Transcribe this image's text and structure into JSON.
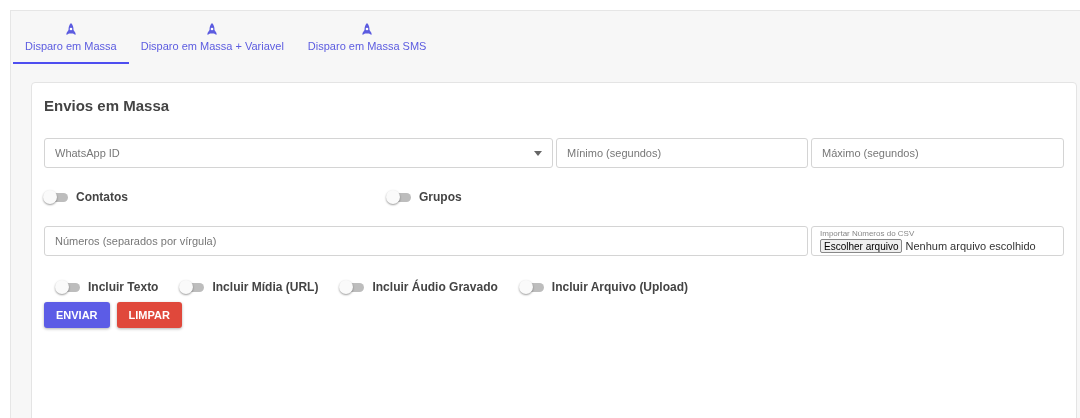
{
  "tabs": [
    {
      "label": "Disparo em Massa",
      "selected": true
    },
    {
      "label": "Disparo em Massa + Variavel",
      "selected": false
    },
    {
      "label": "Disparo em Massa SMS",
      "selected": false
    }
  ],
  "card": {
    "title": "Envios em Massa",
    "whatsapp_select": {
      "placeholder": "WhatsApp ID"
    },
    "minimum_field": {
      "placeholder": "Mínimo (segundos)"
    },
    "maximum_field": {
      "placeholder": "Máximo (segundos)"
    },
    "target_switches": [
      {
        "label": "Contatos",
        "on": false
      },
      {
        "label": "Grupos",
        "on": false
      }
    ],
    "numbers_field": {
      "placeholder": "Números (separados por vírgula)"
    },
    "csv_field": {
      "label": "Importar Números do CSV",
      "button": "Escolher arquivo",
      "status": "Nenhum arquivo escolhido"
    },
    "include_switches": [
      {
        "label": "Incluir Texto",
        "on": false
      },
      {
        "label": "Incluir Mídia (URL)",
        "on": false
      },
      {
        "label": "Incluir Áudio Gravado",
        "on": false
      },
      {
        "label": "Incluir Arquivo (Upload)",
        "on": false
      }
    ],
    "buttons": [
      {
        "label": "ENVIAR",
        "kind": "primary"
      },
      {
        "label": "LIMPAR",
        "kind": "danger"
      }
    ]
  }
}
